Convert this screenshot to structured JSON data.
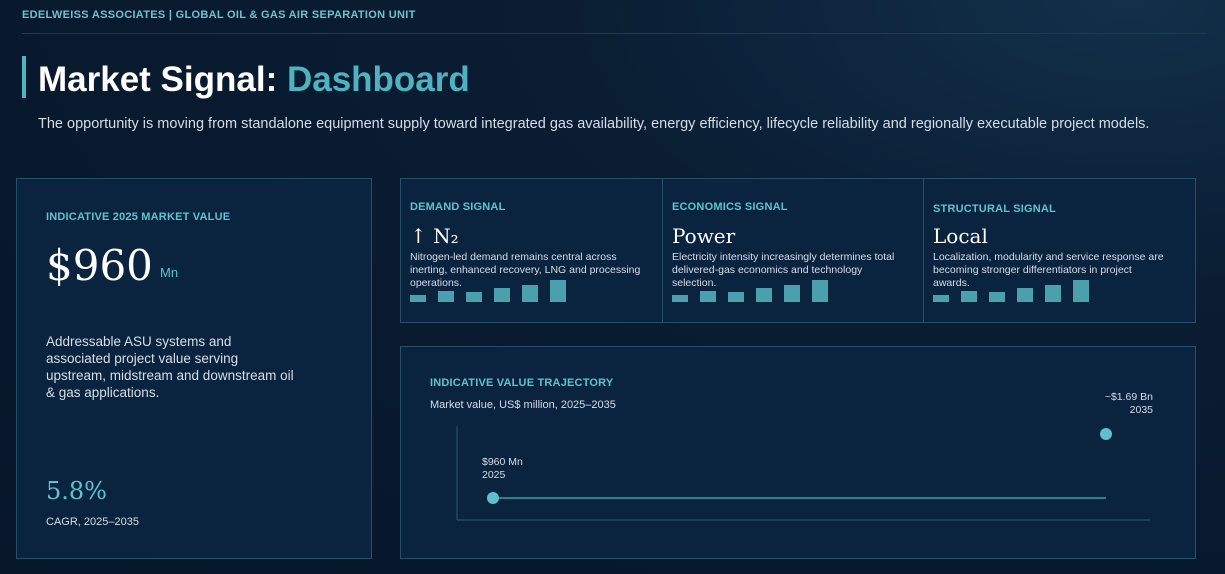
{
  "header": {
    "org": "EDELWEISS ASSOCIATES | GLOBAL OIL & GAS AIR SEPARATION UNIT",
    "title_main": "Market Signal: ",
    "title_accent": "Dashboard",
    "subtitle": "The opportunity is moving from standalone equipment supply toward integrated gas availability, energy efficiency, lifecycle reliability and regionally executable project models."
  },
  "market_card": {
    "label": "INDICATIVE 2025 MARKET VALUE",
    "value": "$960",
    "unit": "Mn",
    "description": "Addressable ASU systems and associated project value serving upstream, midstream and downstream oil & gas applications.",
    "cagr": "5.8%",
    "cagr_label": "CAGR, 2025–2035"
  },
  "signals": [
    {
      "label": "DEMAND SIGNAL",
      "headline": "↑ N₂",
      "description": "Nitrogen-led demand remains central across inerting, enhanced recovery, LNG and processing operations.",
      "bars": [
        0.3,
        0.5,
        0.45,
        0.65,
        0.75,
        1.0
      ]
    },
    {
      "label": "ECONOMICS SIGNAL",
      "headline": "Power",
      "description": "Electricity intensity increasingly determines total delivered-gas economics and technology selection.",
      "bars": [
        0.3,
        0.5,
        0.45,
        0.65,
        0.75,
        1.0
      ]
    },
    {
      "label": "STRUCTURAL SIGNAL",
      "headline": "Local",
      "description": "Localization, modularity and service response are becoming stronger differentiators in project awards.",
      "bars": [
        0.3,
        0.5,
        0.45,
        0.65,
        0.75,
        1.0
      ]
    }
  ],
  "trajectory": {
    "label": "INDICATIVE VALUE TRAJECTORY",
    "subtitle": "Market value, US$ million, 2025–2035",
    "start_value_label": "$960 Mn",
    "start_year_label": "2025",
    "end_value_label": "~$1.69 Bn",
    "end_year_label": "2035"
  },
  "chart_data": {
    "type": "line",
    "x": [
      2025,
      2035
    ],
    "values": [
      960,
      1690
    ],
    "title": "INDICATIVE VALUE TRAJECTORY",
    "subtitle": "Market value, US$ million, 2025–2035",
    "xlabel": "",
    "ylabel": "",
    "grid": false
  },
  "colors": {
    "accent": "#4fb3bf",
    "background": "#071629",
    "card": "#0a2440",
    "border": "#24506a"
  }
}
